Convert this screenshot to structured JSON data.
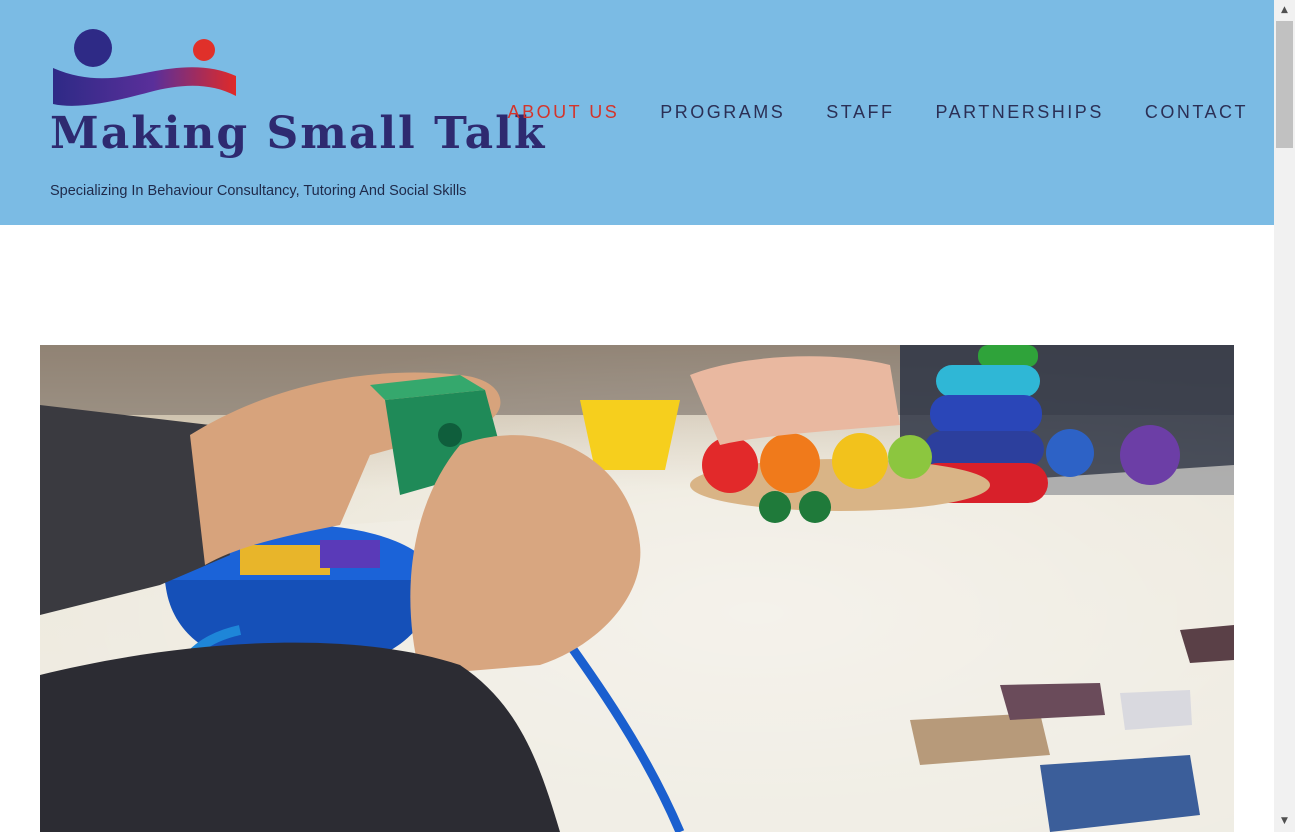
{
  "site": {
    "title": "Making Small Talk",
    "tagline": "Specializing In Behaviour Consultancy, Tutoring And Social Skills",
    "logo_icon": "two-people-wave-logo"
  },
  "nav": {
    "items": [
      {
        "label": "ABOUT US",
        "active": true
      },
      {
        "label": "PROGRAMS",
        "active": false
      },
      {
        "label": "STAFF",
        "active": false
      },
      {
        "label": "PARTNERSHIPS",
        "active": false
      },
      {
        "label": "CONTACT",
        "active": false
      }
    ]
  },
  "colors": {
    "header_bg": "#7bbbe4",
    "nav_text": "#2b2f55",
    "nav_active": "#d4342b",
    "logo_blue": "#2e2a70",
    "logo_red": "#e0302a"
  },
  "hero": {
    "image_subject": "child threading a lace through a green wooden block, toys on table"
  },
  "scrollbar": {
    "up_icon": "triangle-up-icon",
    "down_icon": "triangle-down-icon"
  }
}
